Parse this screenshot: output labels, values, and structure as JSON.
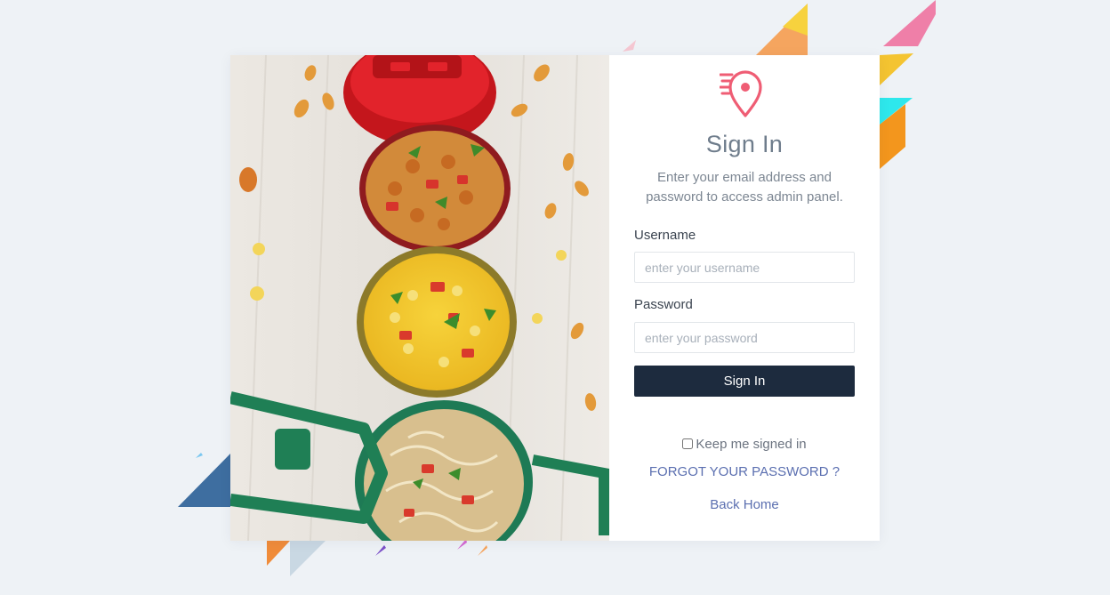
{
  "brand": {
    "logo_icon": "location-pin-speed-icon",
    "accent_color": "#ef5d74"
  },
  "login": {
    "title": "Sign In",
    "subtitle": "Enter your email address and password to access admin panel.",
    "username": {
      "label": "Username",
      "placeholder": "enter your username",
      "value": ""
    },
    "password": {
      "label": "Password",
      "placeholder": "enter your password",
      "value": ""
    },
    "submit_label": "Sign In",
    "remember_label": "Keep me signed in",
    "remember_checked": false,
    "forgot_label": "FORGOT YOUR PASSWORD ?",
    "back_home_label": "Back Home"
  },
  "colors": {
    "page_bg": "#eef2f6",
    "button_bg": "#1d2b3e",
    "link": "#5b6fb0"
  }
}
